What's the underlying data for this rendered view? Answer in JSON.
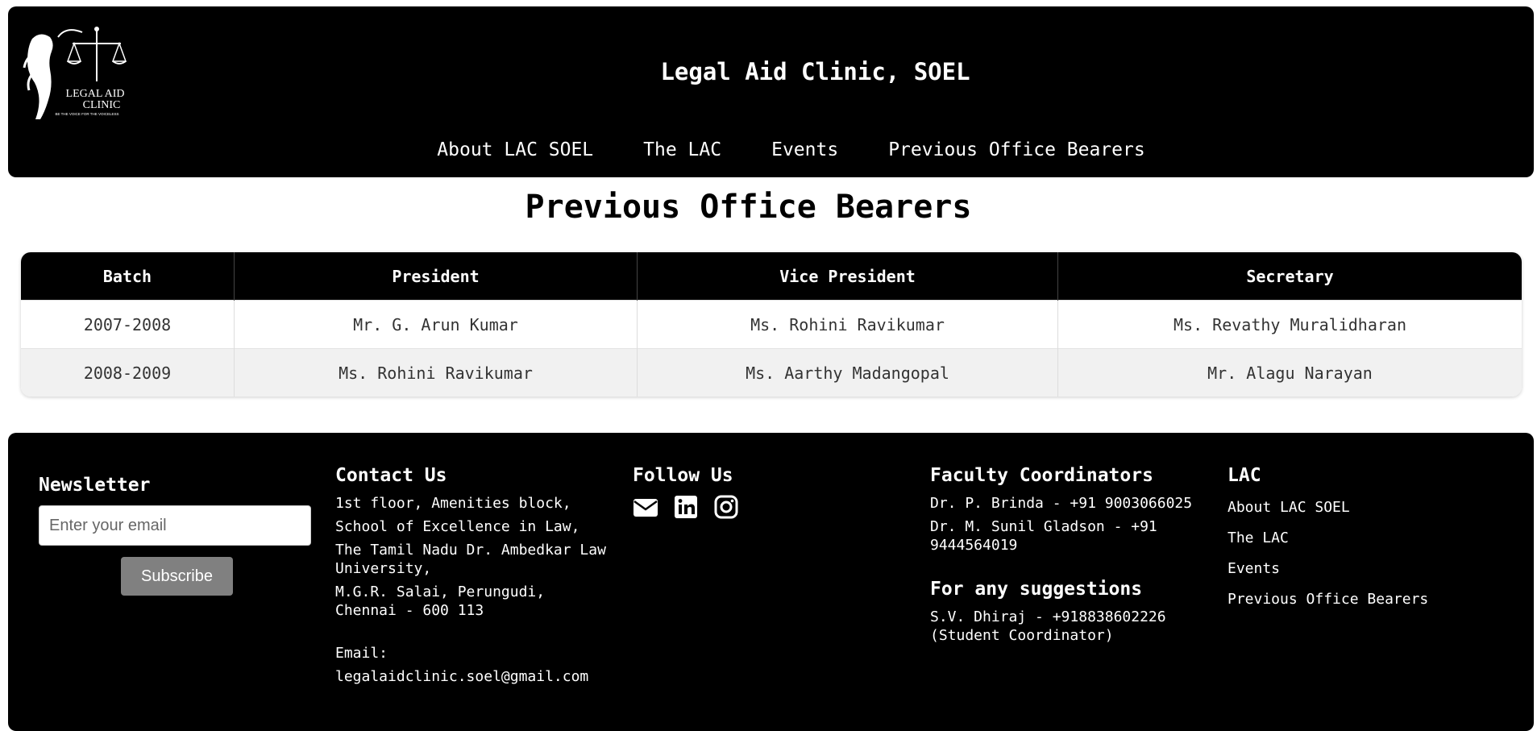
{
  "header": {
    "logo_text": [
      "LEGAL AID",
      "CLINIC",
      "BE THE VOICE FOR THE VOICELESS"
    ],
    "title": "Legal Aid Clinic, SOEL",
    "nav": [
      "About LAC SOEL",
      "The LAC",
      "Events",
      "Previous Office Bearers"
    ]
  },
  "main": {
    "title": "Previous Office Bearers",
    "table": {
      "headers": [
        "Batch",
        "President",
        "Vice President",
        "Secretary"
      ],
      "rows": [
        [
          "2007-2008",
          "Mr. G. Arun Kumar",
          "Ms. Rohini Ravikumar",
          "Ms. Revathy Muralidharan"
        ],
        [
          "2008-2009",
          "Ms. Rohini Ravikumar",
          "Ms. Aarthy Madangopal",
          "Mr. Alagu Narayan"
        ]
      ]
    }
  },
  "footer": {
    "newsletter": {
      "heading": "Newsletter",
      "placeholder": "Enter your email",
      "button": "Subscribe"
    },
    "contact": {
      "heading": "Contact Us",
      "lines": [
        "1st floor, Amenities block,",
        "School of Excellence in Law,",
        "The Tamil Nadu Dr. Ambedkar Law University,",
        "M.G.R. Salai, Perungudi, Chennai - 600 113"
      ],
      "email_label": "Email:",
      "email": "legalaidclinic.soel@gmail.com"
    },
    "follow": {
      "heading": "Follow Us",
      "icons": [
        "envelope-icon",
        "linkedin-icon",
        "instagram-icon"
      ]
    },
    "faculty": {
      "heading": "Faculty Coordinators",
      "lines": [
        "Dr. P. Brinda - +91 9003066025",
        "Dr. M. Sunil Gladson - +91 9444564019"
      ],
      "suggestions_heading": "For any suggestions",
      "suggestions": "S.V. Dhiraj - +918838602226 (Student Coordinator)"
    },
    "lac": {
      "heading": "LAC",
      "links": [
        "About LAC SOEL",
        "The LAC",
        "Events",
        "Previous Office Bearers"
      ]
    }
  }
}
